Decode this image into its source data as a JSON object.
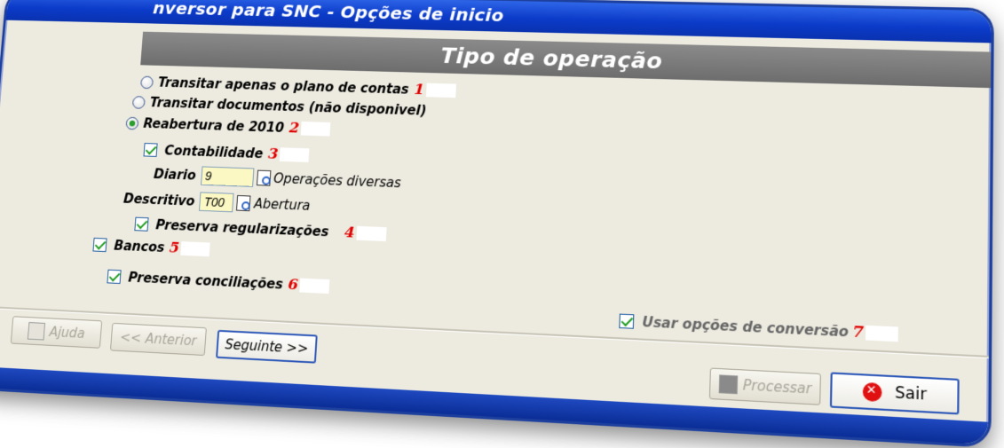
{
  "window": {
    "title": "nversor para SNC - Opções de inicio"
  },
  "banner": {
    "title": "Tipo de operação"
  },
  "options": {
    "radio1": {
      "label": "Transitar apenas o plano de contas",
      "num": "1"
    },
    "radio2": {
      "label": "Transitar documentos (não disponivel)"
    },
    "radio3": {
      "label": "Reabertura de 2010",
      "num": "2"
    },
    "contabilidade": {
      "label": "Contabilidade",
      "num": "3"
    },
    "diario": {
      "label": "Diario",
      "value": "9",
      "desc": "Operações diversas"
    },
    "descritivo": {
      "label": "Descritivo",
      "value": "T00",
      "desc": "Abertura"
    },
    "preserva_reg": {
      "label": "Preserva regularizações",
      "num": "4"
    },
    "bancos": {
      "label": "Bancos",
      "num": "5"
    },
    "preserva_conc": {
      "label": "Preserva conciliações",
      "num": "6"
    },
    "usar_opcoes": {
      "label": "Usar opções de conversão",
      "num": "7"
    }
  },
  "buttons": {
    "ajuda": "Ajuda",
    "anterior": "<< Anterior",
    "seguinte": "Seguinte >>",
    "processar": "Processar",
    "sair": "Sair"
  },
  "icons": {
    "lookup": "magnifier-lookup-icon",
    "save": "floppy-disk-icon",
    "stop": "stop-icon",
    "help": "help-icon"
  }
}
